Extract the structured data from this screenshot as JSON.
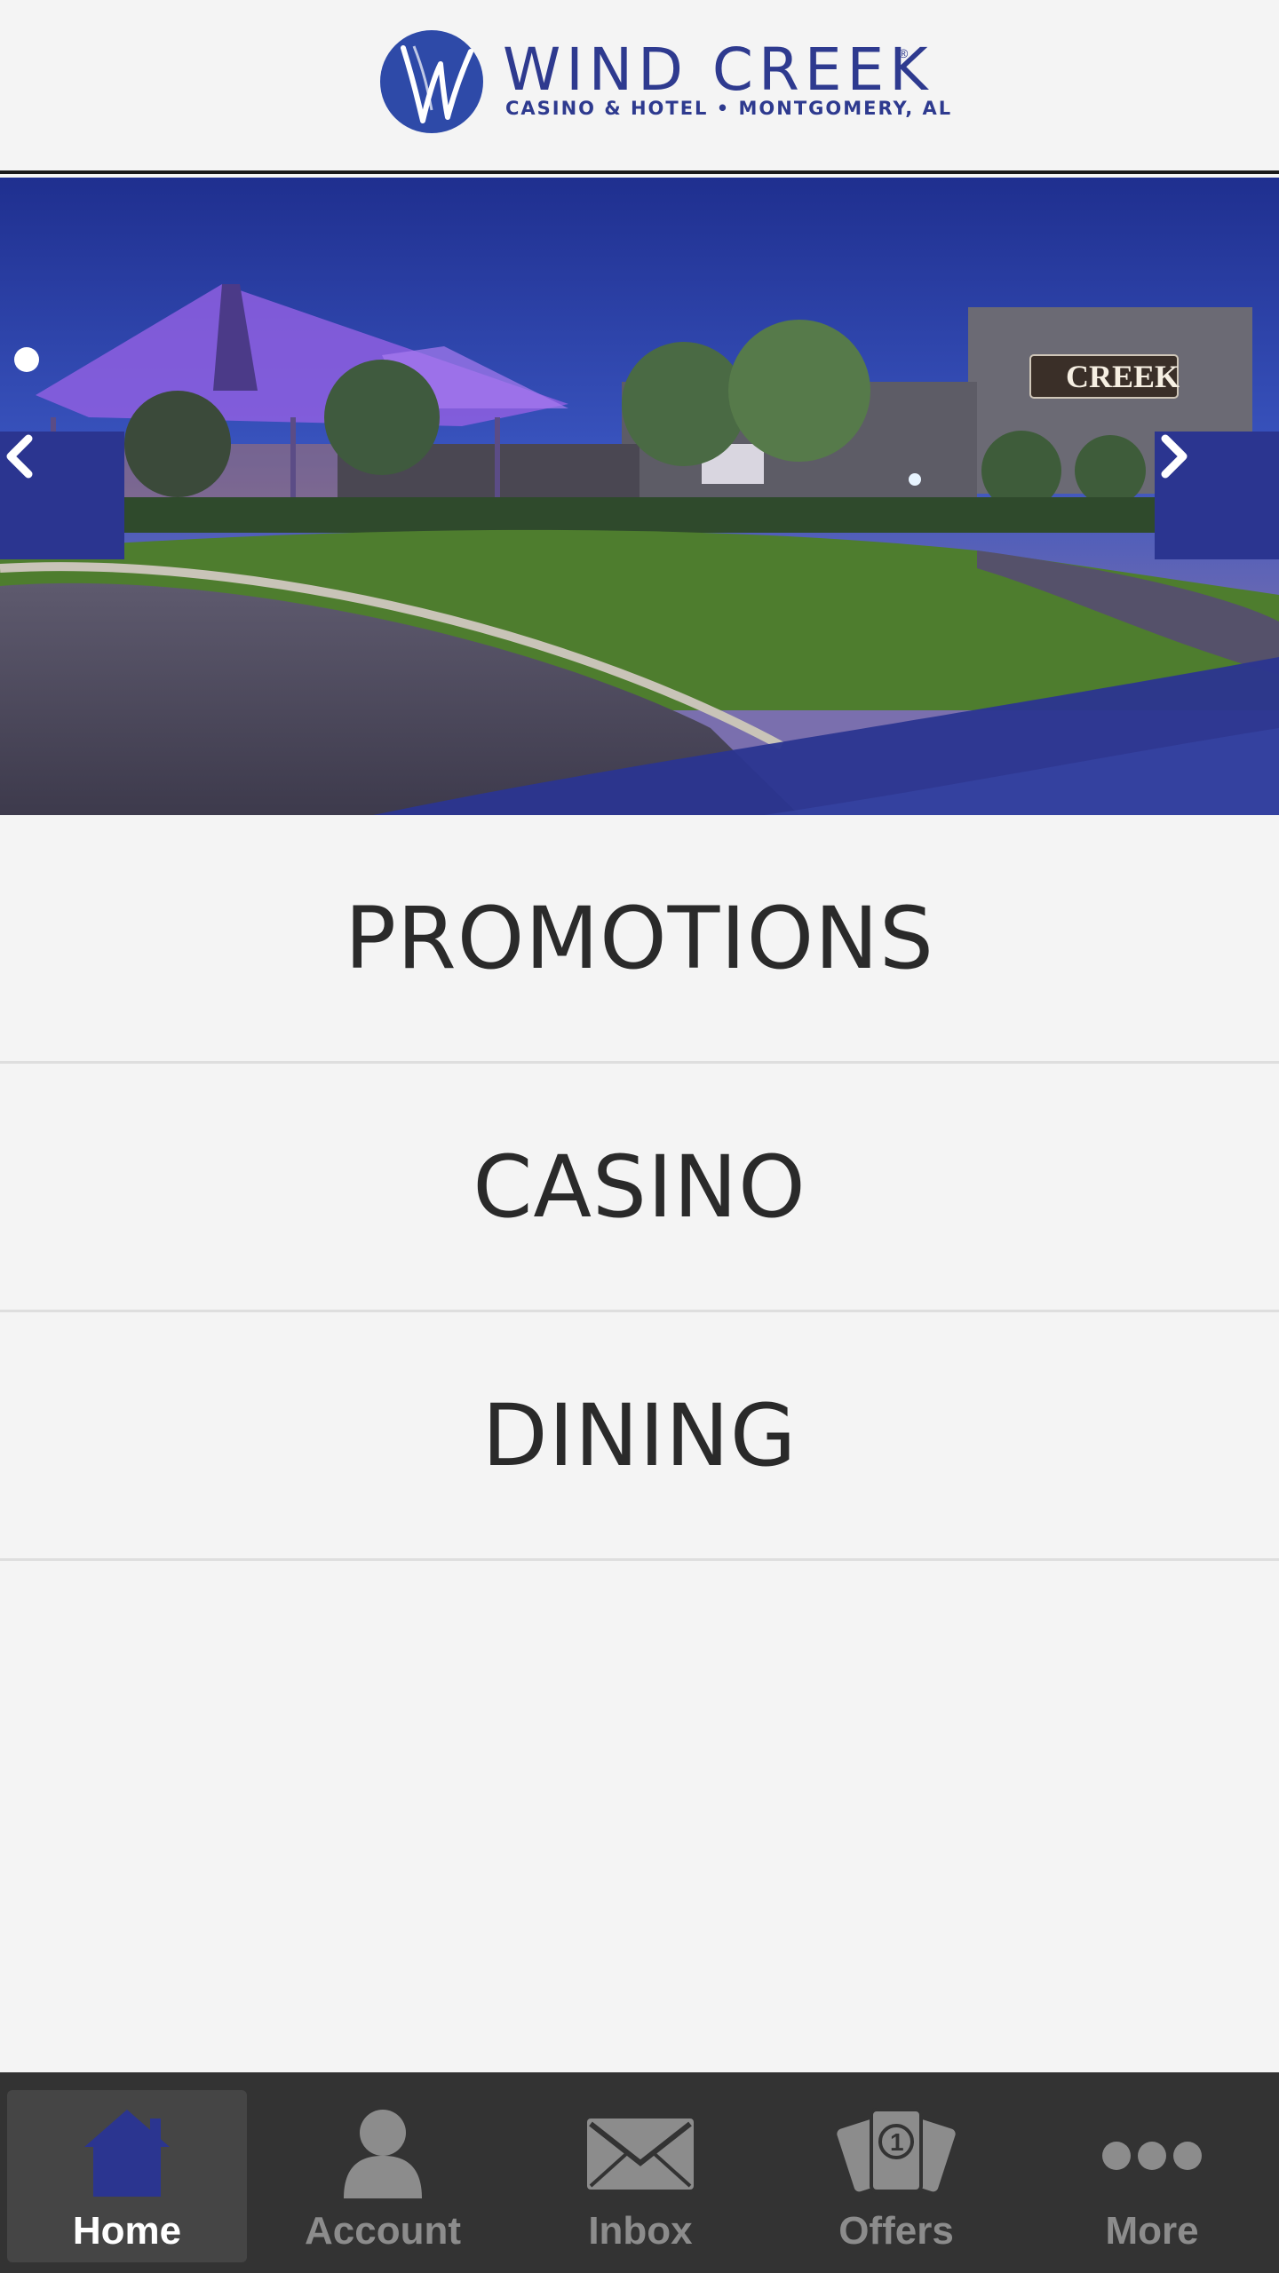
{
  "header": {
    "brand_name": "WIND CREEK",
    "brand_sub": "CASINO & HOTEL • MONTGOMERY, AL",
    "registered": "®",
    "brand_color": "#2e3a8f"
  },
  "hero": {
    "sign_text": "CREEK",
    "prev_icon": "chevron-left-icon",
    "next_icon": "chevron-right-icon",
    "accent_color": "#2b3590"
  },
  "menu": {
    "items": [
      {
        "label": "PROMOTIONS"
      },
      {
        "label": "CASINO"
      },
      {
        "label": "DINING"
      }
    ]
  },
  "tabbar": {
    "active_index": 0,
    "active_icon_color": "#2b3590",
    "tabs": [
      {
        "label": "Home",
        "icon": "home-icon"
      },
      {
        "label": "Account",
        "icon": "person-icon"
      },
      {
        "label": "Inbox",
        "icon": "envelope-icon"
      },
      {
        "label": "Offers",
        "icon": "cards-icon"
      },
      {
        "label": "More",
        "icon": "more-dots-icon"
      }
    ]
  }
}
